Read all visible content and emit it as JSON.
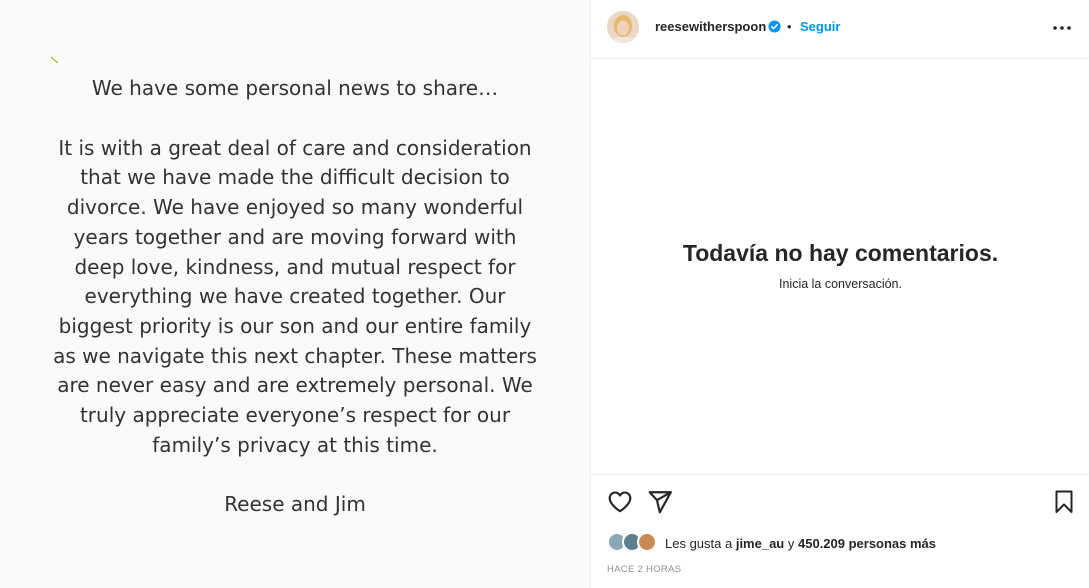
{
  "post": {
    "statement_lines": [
      "We have some personal news to share…",
      "",
      "It is with a great deal of care and consideration",
      "that we have made the difficult decision to",
      "divorce. We have enjoyed so many wonderful",
      "years together and are moving forward with",
      "deep love, kindness, and mutual respect for",
      "everything we have created together. Our",
      "biggest priority is our son and our entire family",
      "as we navigate this next chapter. These matters",
      "are never easy and are extremely personal. We",
      "truly appreciate everyone’s respect for our",
      "family’s privacy at this time.",
      "",
      "Reese and Jim"
    ]
  },
  "header": {
    "username": "reesewitherspoon",
    "separator": "•",
    "follow_label": "Seguir",
    "more_icon": "more-options-icon",
    "verified_color": "#0095f6"
  },
  "comments": {
    "empty_title": "Todavía no hay comentarios.",
    "empty_subtitle": "Inicia la conversación."
  },
  "actions": {
    "like_icon": "heart-icon",
    "share_icon": "paper-plane-icon",
    "save_icon": "bookmark-icon"
  },
  "likes": {
    "prefix": "Les gusta a ",
    "user": "jime_au",
    "middle": " y ",
    "count": "450.209 personas más"
  },
  "timestamp": "HACE 2 HORAS",
  "colors": {
    "accent": "#0095f6",
    "text": "#262626",
    "muted": "#8e8e8e",
    "border": "#efefef"
  }
}
